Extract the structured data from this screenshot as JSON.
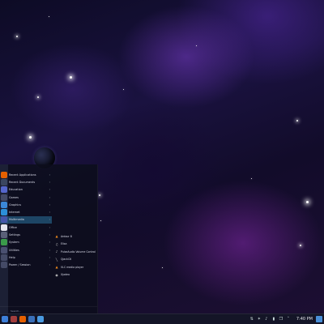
{
  "wallpaper": {
    "theme_colors": [
      "#0d0b25",
      "#1a1240",
      "#7a3cc8",
      "#1d0f33"
    ]
  },
  "menu": {
    "side_strip_label": "",
    "categories": [
      {
        "label": "Recent Applications",
        "icon": "firefox-icon",
        "color": "#e66000"
      },
      {
        "label": "Recent Documents",
        "icon": "document-icon",
        "color": "#3a4660"
      },
      {
        "label": "Education",
        "icon": "education-icon",
        "color": "#5566cc"
      },
      {
        "label": "Games",
        "icon": "games-icon",
        "color": "#444a66"
      },
      {
        "label": "Graphics",
        "icon": "graphics-icon",
        "color": "#3b88d8"
      },
      {
        "label": "Internet",
        "icon": "globe-icon",
        "color": "#2c8fd8"
      },
      {
        "label": "Multimedia",
        "icon": "multimedia-icon",
        "color": "#4455aa"
      },
      {
        "label": "Office",
        "icon": "office-icon",
        "color": "#e6e6f0"
      },
      {
        "label": "Settings",
        "icon": "settings-icon",
        "color": "#5a6078"
      },
      {
        "label": "System",
        "icon": "system-icon",
        "color": "#3a9a4a"
      },
      {
        "label": "Utilities",
        "icon": "utilities-icon",
        "color": "#4a5070"
      },
      {
        "label": "Help",
        "icon": "help-icon",
        "color": "#444a66"
      },
      {
        "label": "Power / Session",
        "icon": "power-icon",
        "color": "#444a66"
      }
    ],
    "selected_index": 6,
    "submenu": [
      {
        "label": "Ardour 8",
        "icon": "ardour-icon",
        "glyph": "▲"
      },
      {
        "label": "Elisa",
        "icon": "elisa-icon",
        "glyph": "♫"
      },
      {
        "label": "PulseAudio Volume Control",
        "icon": "volume-icon",
        "glyph": "♪"
      },
      {
        "label": "QjackCtl",
        "icon": "jack-icon",
        "glyph": "╲"
      },
      {
        "label": "VLC media player",
        "icon": "vlc-icon",
        "glyph": "▲"
      },
      {
        "label": "Xjadeo",
        "icon": "xjadeo-icon",
        "glyph": "◉"
      }
    ],
    "search_placeholder": "Search..."
  },
  "taskbar": {
    "launchers": [
      {
        "icon": "app-launcher-icon",
        "color": "#3d7fd8"
      },
      {
        "icon": "file-manager-icon",
        "color": "#a23d3d"
      },
      {
        "icon": "firefox-icon",
        "color": "#e66000"
      },
      {
        "icon": "terminal-icon",
        "color": "#3a6fb8"
      },
      {
        "icon": "system-settings-icon",
        "color": "#4a9ae0"
      }
    ],
    "tray": [
      {
        "icon": "network-icon",
        "glyph": "⇅"
      },
      {
        "icon": "bluetooth-icon",
        "glyph": "✶"
      },
      {
        "icon": "volume-icon",
        "glyph": "♪"
      },
      {
        "icon": "battery-icon",
        "glyph": "▮"
      },
      {
        "icon": "clipboard-icon",
        "glyph": "❐"
      },
      {
        "icon": "chevron-up-icon",
        "glyph": "˄"
      }
    ],
    "clock": "7:40 PM"
  }
}
